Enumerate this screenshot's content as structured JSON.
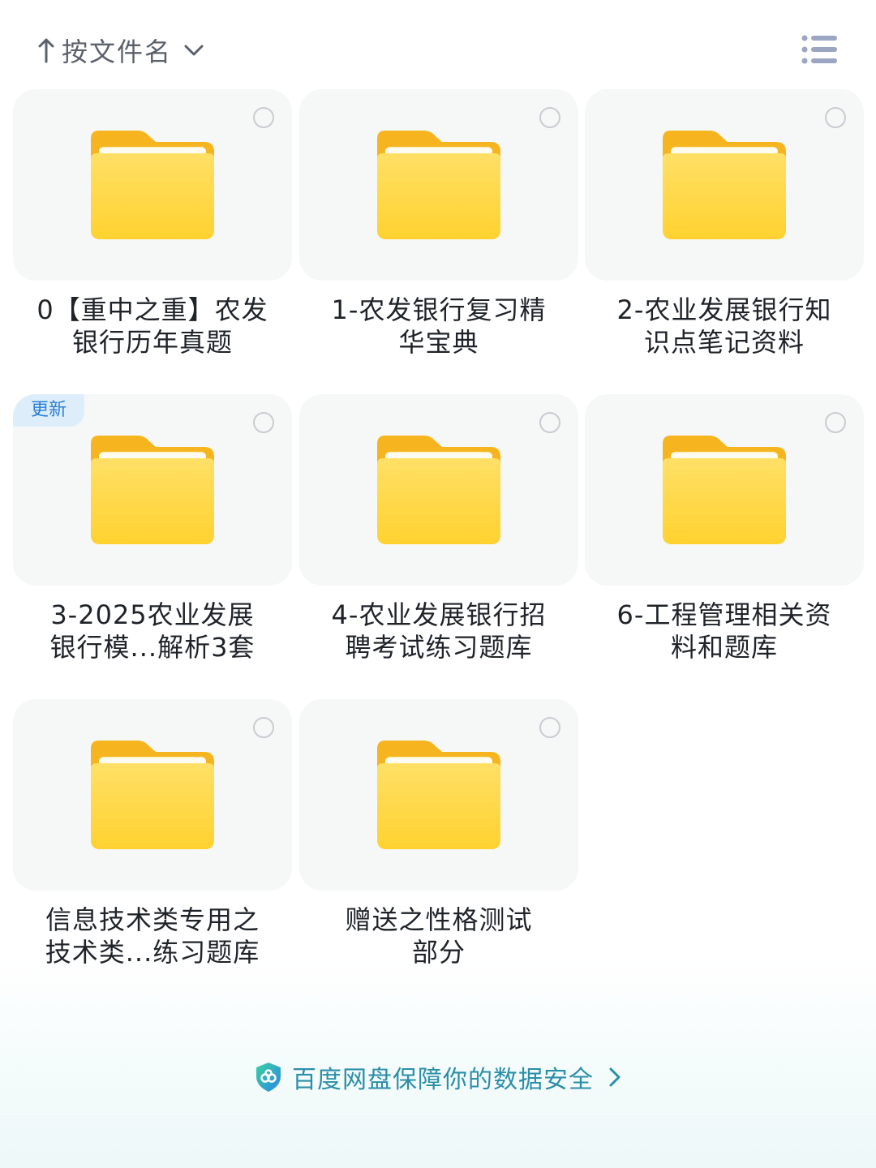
{
  "header": {
    "sort_label": "按文件名",
    "sort_icon": "arrow-up-icon",
    "dropdown_icon": "chevron-down-icon",
    "view_icon": "list-view-icon"
  },
  "folders": [
    {
      "name": "0【重中之重】农发\n银行历年真题",
      "badge": ""
    },
    {
      "name": "1-农发银行复习精\n华宝典",
      "badge": ""
    },
    {
      "name": "2-农业发展银行知\n识点笔记资料",
      "badge": ""
    },
    {
      "name": "3-2025农业发展\n银行模...解析3套",
      "badge": "更新"
    },
    {
      "name": "4-农业发展银行招\n聘考试练习题库",
      "badge": ""
    },
    {
      "name": "6-工程管理相关资\n料和题库",
      "badge": ""
    },
    {
      "name": "信息技术类专用之\n技术类...练习题库",
      "badge": ""
    },
    {
      "name": "赠送之性格测试\n部分",
      "badge": ""
    }
  ],
  "footer": {
    "text": "百度网盘保障你的数据安全",
    "icon": "shield-icon"
  },
  "colors": {
    "folder_body": "#ffd84a",
    "folder_tab": "#f7b81c",
    "accent": "#2a8fa8",
    "badge_text": "#2a7fd8"
  }
}
